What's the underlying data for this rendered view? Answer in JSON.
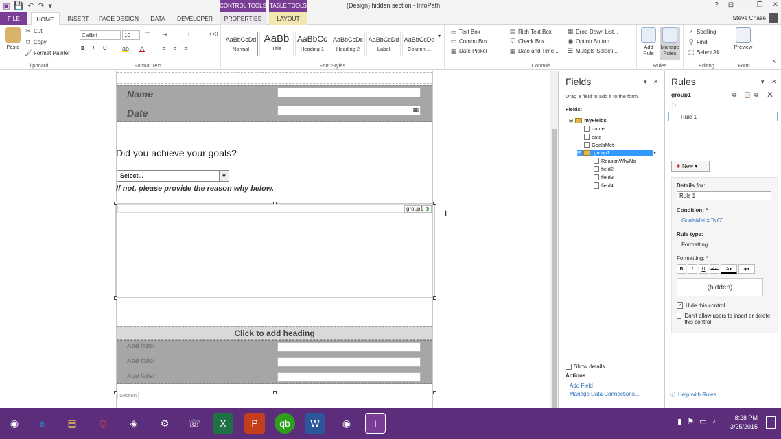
{
  "window": {
    "title": "(Design) hidden section - InfoPath",
    "context_control_tools": "CONTROL TOOLS",
    "context_table_tools": "TABLE TOOLS",
    "user": "Steve Chase",
    "qat_icons": [
      "save-icon",
      "undo-icon",
      "redo-icon"
    ]
  },
  "tabs": [
    "FILE",
    "HOME",
    "INSERT",
    "PAGE DESIGN",
    "DATA",
    "DEVELOPER",
    "PROPERTIES",
    "LAYOUT"
  ],
  "ribbon": {
    "clipboard": {
      "label": "Clipboard",
      "paste": "Paste",
      "cut": "Cut",
      "copy": "Copy",
      "format_painter": "Format Painter"
    },
    "format_text": {
      "label": "Format Text",
      "font": "Calibri",
      "size": "10"
    },
    "font_styles": {
      "label": "Font Styles",
      "styles": [
        {
          "sample": "AaBbCcDd",
          "name": "Normal"
        },
        {
          "sample": "AaBb",
          "name": "Title"
        },
        {
          "sample": "AaBbCc",
          "name": "Heading 1"
        },
        {
          "sample": "AaBbCcDc",
          "name": "Heading 2"
        },
        {
          "sample": "AaBbCcDd",
          "name": "Label"
        },
        {
          "sample": "AaBbCcDd",
          "name": "Column ..."
        }
      ]
    },
    "controls": {
      "label": "Controls",
      "items": [
        "Text Box",
        "Rich Text Box",
        "Drop-Down List...",
        "Combo Box",
        "Check Box",
        "Option Button",
        "Date Picker",
        "Date and Time...",
        "Multiple-Selecti..."
      ]
    },
    "rules": {
      "label": "Rules",
      "add_rule": "Add Rule",
      "manage_rules": "Manage Rules"
    },
    "editing": {
      "label": "Editing",
      "spelling": "Spelling",
      "find": "Find",
      "select_all": "Select All"
    },
    "form": {
      "label": "Form",
      "preview": "Preview"
    }
  },
  "form": {
    "name_label": "Name",
    "date_label": "Date",
    "question": "Did you achieve your goals?",
    "select_value": "Select...",
    "reason_text": "If not, please provide the reason why below.",
    "group_tag": "group1",
    "heading": "Click to add heading",
    "add_labels": [
      "Add label",
      "Add label",
      "Add label"
    ],
    "section_label": "Section"
  },
  "fields_pane": {
    "title": "Fields",
    "hint": "Drag a field to add it to the form.",
    "fields_label": "Fields:",
    "tree": [
      "myFields",
      "name",
      "date",
      "GoalsMet",
      "group1",
      "ReasonWhyNo",
      "field2",
      "field3",
      "field4"
    ],
    "show_details": "Show details",
    "actions_label": "Actions",
    "add_field": "Add Field",
    "manage_connections": "Manage Data Connections..."
  },
  "rules_pane": {
    "title": "Rules",
    "group_name": "group1",
    "rule_item": "Rule 1",
    "new_button": "New",
    "details_for": "Details for:",
    "rule_name": "Rule 1",
    "condition_label": "Condition: *",
    "condition_value": "GoalsMet ≠ \"NO\"",
    "rule_type_label": "Rule type:",
    "rule_type_value": "Formatting",
    "formatting_label": "Formatting: *",
    "formatting_preview": "(hidden)",
    "hide_control": "Hide this control",
    "dont_allow": "Don't allow users to insert or delete this control",
    "help": "Help with Rules"
  },
  "taskbar": {
    "time": "8:28 PM",
    "date": "3/25/2015"
  }
}
